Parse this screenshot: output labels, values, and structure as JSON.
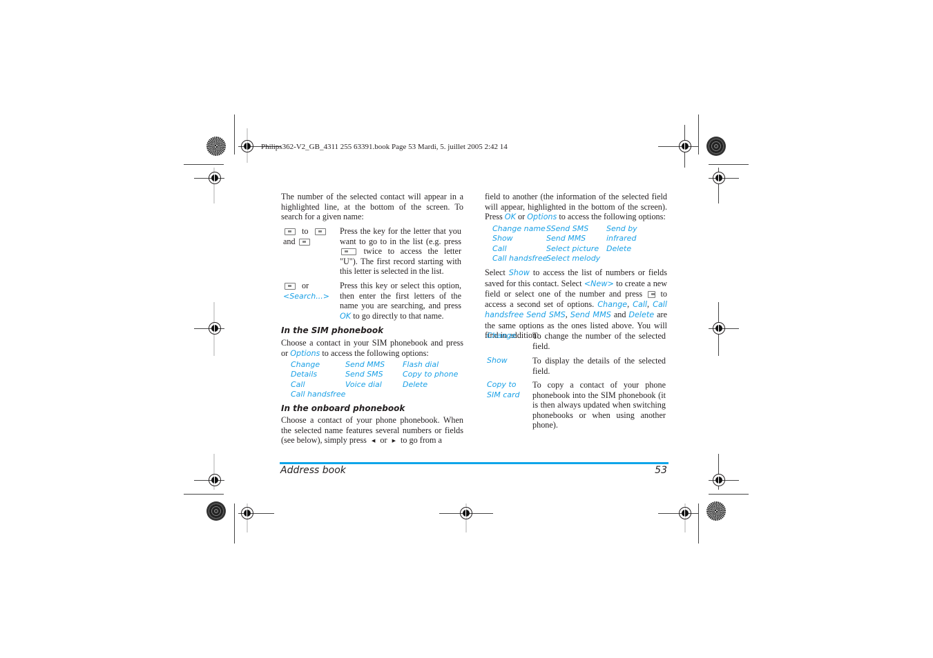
{
  "print_header": "Philips362-V2_GB_4311 255 63391.book  Page 53  Mardi, 5. juillet 2005  2:42 14",
  "left_column": {
    "intro": "The number of the selected contact will appear in a highlighted line, at the bottom of the screen. To search for a given name:",
    "search_rows": [
      {
        "key_text_to": "to",
        "key_text_and": "and",
        "description_before": "Press the key for the letter that you want to go to in the list (e.g. press",
        "description_after": "twice to access the letter \"U\"). The first record starting with this letter is selected in the list."
      },
      {
        "key_text_or": "or",
        "key_option": "<Search...>",
        "description_before": "Press this key or select this option, then enter the first letters of the name you are searching, and press",
        "description_link": "OK",
        "description_after": "to go directly to that name."
      }
    ],
    "sim_section": {
      "heading": "In the SIM phonebook",
      "text_before": "Choose a contact in your SIM phonebook and press or",
      "text_link": "Options",
      "text_after": "to access the following options:",
      "options": [
        [
          "Change",
          "Send MMS",
          "Flash dial"
        ],
        [
          "Details",
          "Send SMS",
          "Copy to phone"
        ],
        [
          "Call",
          "Voice dial",
          "Delete"
        ],
        [
          "Call handsfree",
          "",
          ""
        ]
      ]
    },
    "onboard_section": {
      "heading": "In the onboard phonebook",
      "text_before": "Choose a contact of your phone phonebook. When the selected name features several numbers or fields (see below), simply press",
      "text_or": "or",
      "text_after": "to go from a"
    }
  },
  "right_column": {
    "continuation": "field to another (the information of the selected field will appear, highlighted in the bottom of the screen).",
    "press_text": "Press",
    "press_ok": "OK",
    "press_or": "or",
    "press_options": "Options",
    "press_after": "to access the following options:",
    "options": [
      [
        "Change name",
        "SSend SMS",
        "Send by"
      ],
      [
        "Show",
        "Send MMS",
        "infrared"
      ],
      [
        "Call",
        "Select picture",
        "Delete"
      ],
      [
        "Call handsfree",
        "Select melody",
        ""
      ]
    ],
    "select_para": {
      "t1": "Select",
      "l1": "Show",
      "t2": "to access the list of numbers or fields saved for this contact. Select",
      "l2": "<New>",
      "t3": "to create a new field or select one of the number and press",
      "t4": "to access a second set of options.",
      "l3": "Change",
      "l4": "Call",
      "l5": "Call handsfree",
      "l6": "Send SMS",
      "l7": "Send MMS",
      "t5": "and",
      "l8": "Delete",
      "t6": "are the same options as the ones listed above. You will find in addition:"
    },
    "definitions": [
      {
        "term": "Change",
        "description": "To change the number of the selected field."
      },
      {
        "term": "Show",
        "description": "To display the details of the selected field."
      },
      {
        "term": "Copy to SIM card",
        "description": "To copy a contact of your phone phonebook into the SIM phonebook (it is then always updated when switching phonebooks or when using another phone)."
      }
    ]
  },
  "footer": {
    "section_title": "Address book",
    "page_number": "53",
    "accent_color": "#0ea5e9"
  },
  "link_color": "#1aa0e6"
}
